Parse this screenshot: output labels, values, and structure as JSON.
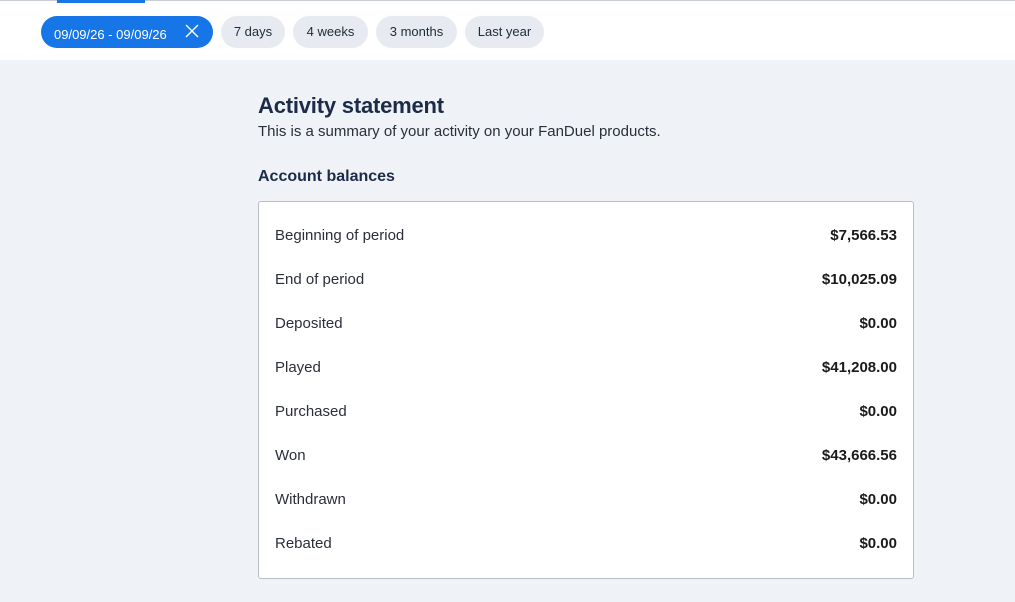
{
  "filters": {
    "active_range": "09/09/26 - 09/09/26",
    "presets": [
      "7 days",
      "4 weeks",
      "3 months",
      "Last year"
    ]
  },
  "statement": {
    "title": "Activity statement",
    "subtitle": "This is a summary of your activity on your FanDuel products.",
    "section_heading": "Account balances",
    "balances": [
      {
        "label": "Beginning of period",
        "value": "$7,566.53"
      },
      {
        "label": "End of period",
        "value": "$10,025.09"
      },
      {
        "label": "Deposited",
        "value": "$0.00"
      },
      {
        "label": "Played",
        "value": "$41,208.00"
      },
      {
        "label": "Purchased",
        "value": "$0.00"
      },
      {
        "label": "Won",
        "value": "$43,666.56"
      },
      {
        "label": "Withdrawn",
        "value": "$0.00"
      },
      {
        "label": "Rebated",
        "value": "$0.00"
      }
    ]
  },
  "colors": {
    "accent": "#1676e8",
    "chip_background": "#e7ebf1",
    "page_background": "#eff2f6",
    "heading": "#1b2b48"
  }
}
